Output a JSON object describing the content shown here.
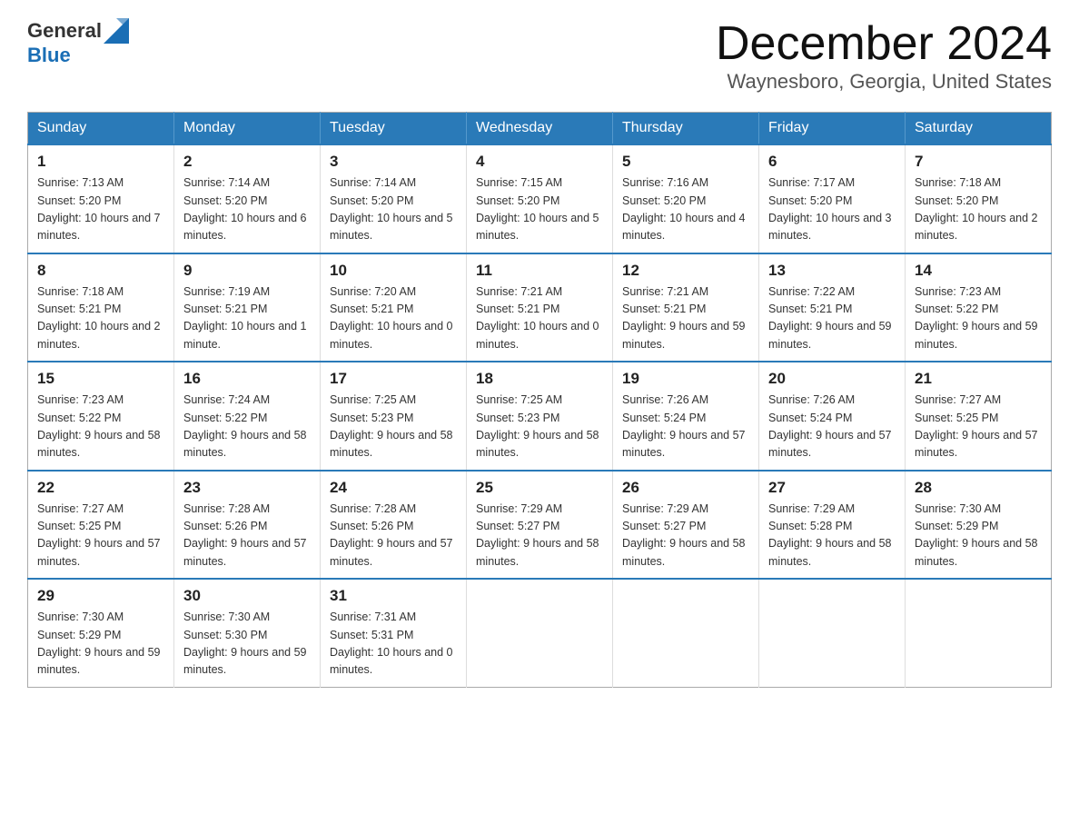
{
  "header": {
    "logo_general": "General",
    "logo_blue": "Blue",
    "month_title": "December 2024",
    "location": "Waynesboro, Georgia, United States"
  },
  "days_of_week": [
    "Sunday",
    "Monday",
    "Tuesday",
    "Wednesday",
    "Thursday",
    "Friday",
    "Saturday"
  ],
  "weeks": [
    [
      {
        "day": "1",
        "sunrise": "7:13 AM",
        "sunset": "5:20 PM",
        "daylight": "10 hours and 7 minutes."
      },
      {
        "day": "2",
        "sunrise": "7:14 AM",
        "sunset": "5:20 PM",
        "daylight": "10 hours and 6 minutes."
      },
      {
        "day": "3",
        "sunrise": "7:14 AM",
        "sunset": "5:20 PM",
        "daylight": "10 hours and 5 minutes."
      },
      {
        "day": "4",
        "sunrise": "7:15 AM",
        "sunset": "5:20 PM",
        "daylight": "10 hours and 5 minutes."
      },
      {
        "day": "5",
        "sunrise": "7:16 AM",
        "sunset": "5:20 PM",
        "daylight": "10 hours and 4 minutes."
      },
      {
        "day": "6",
        "sunrise": "7:17 AM",
        "sunset": "5:20 PM",
        "daylight": "10 hours and 3 minutes."
      },
      {
        "day": "7",
        "sunrise": "7:18 AM",
        "sunset": "5:20 PM",
        "daylight": "10 hours and 2 minutes."
      }
    ],
    [
      {
        "day": "8",
        "sunrise": "7:18 AM",
        "sunset": "5:21 PM",
        "daylight": "10 hours and 2 minutes."
      },
      {
        "day": "9",
        "sunrise": "7:19 AM",
        "sunset": "5:21 PM",
        "daylight": "10 hours and 1 minute."
      },
      {
        "day": "10",
        "sunrise": "7:20 AM",
        "sunset": "5:21 PM",
        "daylight": "10 hours and 0 minutes."
      },
      {
        "day": "11",
        "sunrise": "7:21 AM",
        "sunset": "5:21 PM",
        "daylight": "10 hours and 0 minutes."
      },
      {
        "day": "12",
        "sunrise": "7:21 AM",
        "sunset": "5:21 PM",
        "daylight": "9 hours and 59 minutes."
      },
      {
        "day": "13",
        "sunrise": "7:22 AM",
        "sunset": "5:21 PM",
        "daylight": "9 hours and 59 minutes."
      },
      {
        "day": "14",
        "sunrise": "7:23 AM",
        "sunset": "5:22 PM",
        "daylight": "9 hours and 59 minutes."
      }
    ],
    [
      {
        "day": "15",
        "sunrise": "7:23 AM",
        "sunset": "5:22 PM",
        "daylight": "9 hours and 58 minutes."
      },
      {
        "day": "16",
        "sunrise": "7:24 AM",
        "sunset": "5:22 PM",
        "daylight": "9 hours and 58 minutes."
      },
      {
        "day": "17",
        "sunrise": "7:25 AM",
        "sunset": "5:23 PM",
        "daylight": "9 hours and 58 minutes."
      },
      {
        "day": "18",
        "sunrise": "7:25 AM",
        "sunset": "5:23 PM",
        "daylight": "9 hours and 58 minutes."
      },
      {
        "day": "19",
        "sunrise": "7:26 AM",
        "sunset": "5:24 PM",
        "daylight": "9 hours and 57 minutes."
      },
      {
        "day": "20",
        "sunrise": "7:26 AM",
        "sunset": "5:24 PM",
        "daylight": "9 hours and 57 minutes."
      },
      {
        "day": "21",
        "sunrise": "7:27 AM",
        "sunset": "5:25 PM",
        "daylight": "9 hours and 57 minutes."
      }
    ],
    [
      {
        "day": "22",
        "sunrise": "7:27 AM",
        "sunset": "5:25 PM",
        "daylight": "9 hours and 57 minutes."
      },
      {
        "day": "23",
        "sunrise": "7:28 AM",
        "sunset": "5:26 PM",
        "daylight": "9 hours and 57 minutes."
      },
      {
        "day": "24",
        "sunrise": "7:28 AM",
        "sunset": "5:26 PM",
        "daylight": "9 hours and 57 minutes."
      },
      {
        "day": "25",
        "sunrise": "7:29 AM",
        "sunset": "5:27 PM",
        "daylight": "9 hours and 58 minutes."
      },
      {
        "day": "26",
        "sunrise": "7:29 AM",
        "sunset": "5:27 PM",
        "daylight": "9 hours and 58 minutes."
      },
      {
        "day": "27",
        "sunrise": "7:29 AM",
        "sunset": "5:28 PM",
        "daylight": "9 hours and 58 minutes."
      },
      {
        "day": "28",
        "sunrise": "7:30 AM",
        "sunset": "5:29 PM",
        "daylight": "9 hours and 58 minutes."
      }
    ],
    [
      {
        "day": "29",
        "sunrise": "7:30 AM",
        "sunset": "5:29 PM",
        "daylight": "9 hours and 59 minutes."
      },
      {
        "day": "30",
        "sunrise": "7:30 AM",
        "sunset": "5:30 PM",
        "daylight": "9 hours and 59 minutes."
      },
      {
        "day": "31",
        "sunrise": "7:31 AM",
        "sunset": "5:31 PM",
        "daylight": "10 hours and 0 minutes."
      },
      null,
      null,
      null,
      null
    ]
  ]
}
